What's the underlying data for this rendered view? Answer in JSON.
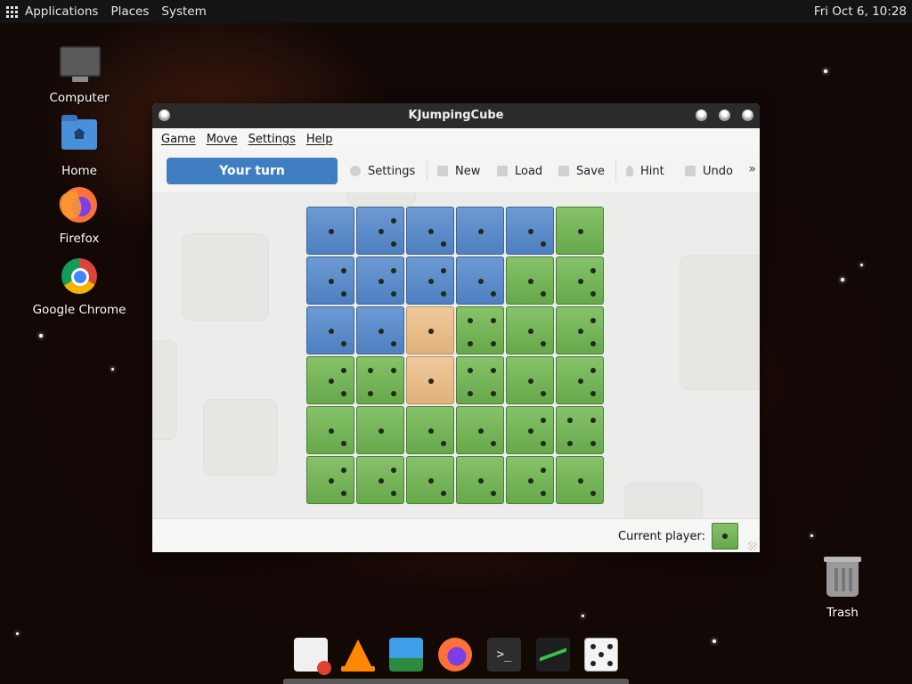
{
  "top_panel": {
    "applications": "Applications",
    "places": "Places",
    "system": "System",
    "clock": "Fri Oct  6, 10:28"
  },
  "desktop_icons": [
    {
      "label": "Computer",
      "icon": "computer-icon"
    },
    {
      "label": "Home",
      "icon": "home-folder-icon"
    },
    {
      "label": "Firefox",
      "icon": "firefox-icon"
    },
    {
      "label": "Google Chrome",
      "icon": "chrome-icon"
    },
    {
      "label": "Trash",
      "icon": "trash-icon"
    }
  ],
  "window": {
    "title": "KJumpingCube",
    "menu": [
      "Game",
      "Move",
      "Settings",
      "Help"
    ],
    "toolbar": {
      "turn_label": "Your turn",
      "settings": "Settings",
      "new": "New",
      "load": "Load",
      "save": "Save",
      "hint": "Hint",
      "undo": "Undo",
      "overflow": "»"
    },
    "board": {
      "rows": [
        [
          {
            "c": "blue",
            "n": 1
          },
          {
            "c": "blue",
            "n": 3
          },
          {
            "c": "blue",
            "n": 2
          },
          {
            "c": "blue",
            "n": 1
          },
          {
            "c": "blue",
            "n": 2
          },
          {
            "c": "green",
            "n": 1
          }
        ],
        [
          {
            "c": "blue",
            "n": 3
          },
          {
            "c": "blue",
            "n": 3
          },
          {
            "c": "blue",
            "n": 3
          },
          {
            "c": "blue",
            "n": 2
          },
          {
            "c": "green",
            "n": 2
          },
          {
            "c": "green",
            "n": 3
          }
        ],
        [
          {
            "c": "blue",
            "n": 2
          },
          {
            "c": "blue",
            "n": 2
          },
          {
            "c": "tan",
            "n": 1
          },
          {
            "c": "green",
            "n": 4
          },
          {
            "c": "green",
            "n": 2
          },
          {
            "c": "green",
            "n": 3
          }
        ],
        [
          {
            "c": "green",
            "n": 3
          },
          {
            "c": "green",
            "n": 4
          },
          {
            "c": "tan",
            "n": 1
          },
          {
            "c": "green",
            "n": 4
          },
          {
            "c": "green",
            "n": 2
          },
          {
            "c": "green",
            "n": 3
          }
        ],
        [
          {
            "c": "green",
            "n": 2
          },
          {
            "c": "green",
            "n": 1
          },
          {
            "c": "green",
            "n": 2
          },
          {
            "c": "green",
            "n": 2
          },
          {
            "c": "green",
            "n": 3
          },
          {
            "c": "green",
            "n": 4
          }
        ],
        [
          {
            "c": "green",
            "n": 3
          },
          {
            "c": "green",
            "n": 3
          },
          {
            "c": "green",
            "n": 2
          },
          {
            "c": "green",
            "n": 2
          },
          {
            "c": "green",
            "n": 3
          },
          {
            "c": "green",
            "n": 2
          }
        ]
      ],
      "colors": {
        "blue": "#5a8bc9",
        "green": "#74b157",
        "tan": "#e8bd88"
      }
    },
    "status": {
      "current_player_label": "Current player:",
      "current_player_color": "green"
    }
  },
  "dock": [
    "text-editor-icon",
    "vlc-icon",
    "image-viewer-icon",
    "firefox-icon",
    "terminal-icon",
    "system-monitor-icon",
    "dice-game-icon"
  ]
}
